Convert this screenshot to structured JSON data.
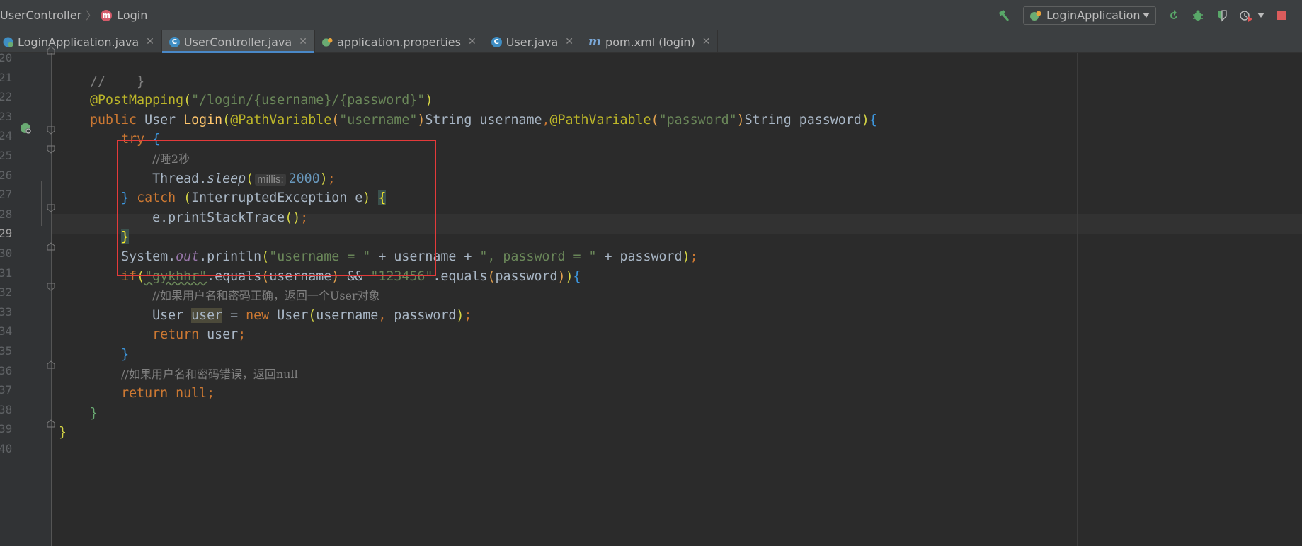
{
  "breadcrumb": {
    "class_name": "UserController",
    "method_name": "Login"
  },
  "run_config": {
    "name": "LoginApplication"
  },
  "tabs": [
    {
      "label": "LoginApplication.java"
    },
    {
      "label": "UserController.java"
    },
    {
      "label": "application.properties"
    },
    {
      "label": "User.java"
    },
    {
      "label": "pom.xml (login)"
    }
  ],
  "line_numbers": [
    "20",
    "21",
    "22",
    "23",
    "24",
    "25",
    "26",
    "27",
    "28",
    "29",
    "30",
    "31",
    "32",
    "33",
    "34",
    "35",
    "36",
    "37",
    "38",
    "39",
    "40"
  ],
  "current_line": "29",
  "code": {
    "l20": "//    }",
    "l22_ann": "@PostMapping",
    "l22_path": "\"/login/{username}/{password}\"",
    "l23_public": "public",
    "l23_type": "User",
    "l23_method": "Login",
    "l23_ann1": "@PathVariable",
    "l23_str1": "\"username\"",
    "l23_param1": "String username",
    "l23_ann2": "@PathVariable",
    "l23_str2": "\"password\"",
    "l23_param2": "String password",
    "l24_try": "try",
    "l25_comment": "//睡2秒",
    "l26_thread": "Thread.",
    "l26_sleep": "sleep",
    "l26_hint": "millis:",
    "l26_value": "2000",
    "l27_catch": "catch",
    "l27_exception": "InterruptedException e",
    "l28_stmt": "e.printStackTrace",
    "l30_system": "System.",
    "l30_out": "out",
    "l30_println": ".println",
    "l30_str1": "\"username = \"",
    "l30_plus1": " + username + ",
    "l30_str2": "\", password = \"",
    "l30_plus2": " + password",
    "l31_if": "if",
    "l31_str1": "\"gykhhr\"",
    "l31_equals1": ".equals",
    "l31_arg1": "username",
    "l31_and": " && ",
    "l31_str2": "\"123456\"",
    "l31_equals2": ".equals",
    "l31_arg2": "password",
    "l32_comment": "//如果用户名和密码正确，返回一个User对象",
    "l33_type": "User ",
    "l33_var": "user",
    "l33_assign": " = ",
    "l33_new": "new",
    "l33_ctor": " User",
    "l33_args1": "username",
    "l33_args2": " password",
    "l34_return": "return",
    "l34_value": " user",
    "l36_comment": "//如果用户名和密码错误，返回null",
    "l37_return": "return null"
  },
  "colors": {
    "keyword": "#cc7832",
    "string": "#6a8759",
    "annotation": "#bbb529",
    "comment": "#808080",
    "number": "#6897bb",
    "highlight_box": "#e43a3a"
  }
}
